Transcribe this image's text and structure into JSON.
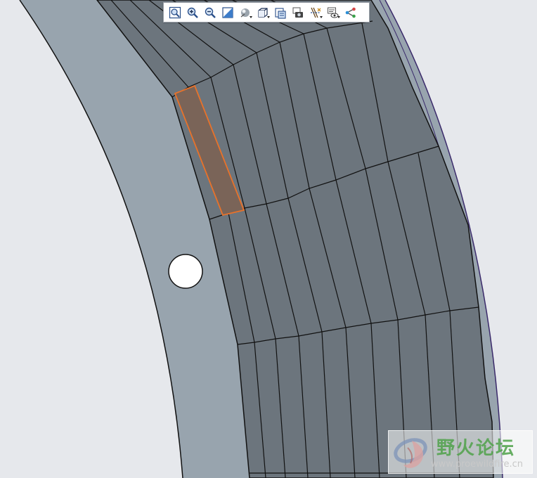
{
  "app": {
    "theme_bg": "#e6e8ec",
    "part_color": "#98a4ae",
    "face_color": "#6c757d",
    "highlight_color": "#e8722a"
  },
  "toolbar": {
    "buttons": [
      {
        "icon": "zoom-fit-icon",
        "name": "refit-button"
      },
      {
        "icon": "zoom-in-icon",
        "name": "zoom-in-button"
      },
      {
        "icon": "zoom-out-icon",
        "name": "zoom-out-button"
      },
      {
        "icon": "repaint-icon",
        "name": "repaint-button"
      },
      {
        "icon": "display-style-icon",
        "name": "display-style-button",
        "dropdown": true
      },
      {
        "icon": "saved-orientations-icon",
        "name": "saved-orientations-button",
        "dropdown": true
      },
      {
        "icon": "view-manager-icon",
        "name": "view-manager-button"
      },
      {
        "icon": "render-icon",
        "name": "render-button"
      },
      {
        "icon": "datum-display-icon",
        "name": "datum-display-button",
        "dropdown": true
      },
      {
        "icon": "annotation-display-icon",
        "name": "annotation-display-button",
        "dropdown": true
      },
      {
        "icon": "spin-center-icon",
        "name": "spin-center-button"
      }
    ]
  },
  "watermark": {
    "title": "野火论坛",
    "url": "www.proewildfire.cn"
  }
}
